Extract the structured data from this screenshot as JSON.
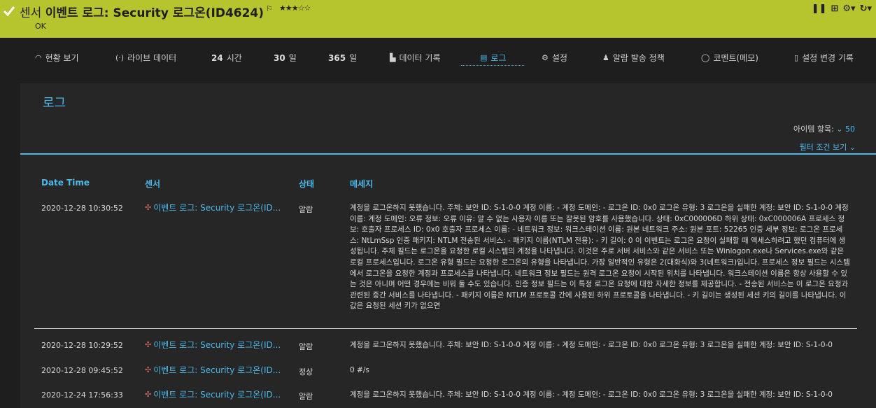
{
  "header": {
    "title_prefix": "센서",
    "title_main": "이벤트 로그: Security 로그온(ID4624)",
    "stars": "★★★☆☆",
    "status": "OK",
    "flag_icon": "flag-icon",
    "icons": [
      "pause-icon",
      "add-icon",
      "settings-icon",
      "refresh-icon"
    ]
  },
  "tabs": [
    {
      "label": "현황 보기",
      "icon": "overview-icon"
    },
    {
      "label": "라이브 데이터",
      "icon": "live-data-icon"
    },
    {
      "num": "24",
      "label": "시간"
    },
    {
      "num": "30",
      "label": "일"
    },
    {
      "num": "365",
      "label": "일"
    },
    {
      "label": "데이터 기록",
      "icon": "history-icon"
    },
    {
      "label": "로그",
      "icon": "log-icon"
    },
    {
      "label": "설정",
      "icon": "gear-icon"
    },
    {
      "label": "알람 발송 정책",
      "icon": "bell-icon"
    },
    {
      "label": "코멘트(메모)",
      "icon": "comment-icon"
    },
    {
      "label": "설정 변경 기록",
      "icon": "change-log-icon"
    }
  ],
  "panel": {
    "title": "로그",
    "items_label": "아이템 항목:",
    "items_value": "50",
    "filter_label": "필터 조건 보기"
  },
  "table": {
    "columns": [
      "Date Time",
      "센서",
      "상태",
      "메세지"
    ],
    "rows": [
      {
        "date": "2020-12-28 10:30:52",
        "sensor": "이벤트 로그: Security 로그온(ID...",
        "state": "알람",
        "message": "계정을 로그온하지 못했습니다. 주체: 보안 ID: S-1-0-0 계정 이름: - 계정 도메인: - 로그온 ID: 0x0 로그온 유형: 3 로그온을 실패한 계정: 보안 ID: S-1-0-0 계정 이름: 계정 도메인: 오류 정보: 오류 이유: 알 수 없는 사용자 이름 또는 잘못된 암호를 사용했습니다. 상태: 0xC000006D 하위 상태: 0xC000006A 프로세스 정보: 호출자 프로세스 ID: 0x0 호출자 프로세스 이름: - 네트워크 정보: 워크스테이션 이름: 원본 네트워크 주소: 원본 포트: 52265 인증 세부 정보: 로그온 프로세스: NtLmSsp 인증 패키지: NTLM 전송된 서비스: - 패키지 이름(NTLM 전용): - 키 길이: 0 이 이벤트는 로그온 요청이 실패할 때 액세스하려고 했던 컴퓨터에 생성됩니다. 주체 필드는 로그온을 요청한 로컬 시스템의 계정을 나타냅니다. 이것은 주로 서버 서비스와 같은 서비스 또는 Winlogon.exe나 Services.exe와 같은 로컬 프로세스입니다. 로그온 유형 필드는 요청한 로그온의 유형을 나타냅니다. 가장 일반적인 유형은 2(대화식)와 3(네트워크)입니다. 프로세스 정보 필드는 시스템에서 로그온을 요청한 계정과 프로세스를 나타냅니다. 네트워크 정보 필드는 원격 로그온 요청이 시작된 위치를 나타냅니다. 워크스테이션 이름은 항상 사용할 수 있는 것은 아니며 어떤 경우에는 비워 둘 수도 있습니다. 인증 정보 필드는 이 특정 로그온 요청에 대한 자세한 정보를 제공합니다. - 전송된 서비스는 이 로그온 요청과 관련된 중간 서비스를 나타냅니다. - 패키지 이름은 NTLM 프로토콜 간에 사용된 하위 프로토콜을 나타냅니다. - 키 길이는 생성된 세션 키의 길이를 나타냅니다. 이 값은 요청된 세션 키가 없으면"
      },
      {
        "date": "2020-12-28 10:29:52",
        "sensor": "이벤트 로그: Security 로그온(ID...",
        "state": "알람",
        "message": "계정을 로그온하지 못했습니다. 주체: 보안 ID: S-1-0-0 계정 이름: - 계정 도메인: - 로그온 ID: 0x0 로그온 유형: 3 로그온을 실패한 계정: 보안 ID: S-1-0-0"
      },
      {
        "date": "2020-12-28 09:45:52",
        "sensor": "이벤트 로그: Security 로그온(ID...",
        "state": "정상",
        "message": "0 #/s"
      },
      {
        "date": "2020-12-24 17:56:33",
        "sensor": "이벤트 로그: Security 로그온(ID...",
        "state": "알람",
        "message": "계정을 로그온하지 못했습니다. 주체: 보안 ID: S-1-0-0 계정 이름: - 계정 도메인: - 로그온 ID: 0x0 로그온 유형: 3 로그온을 실패한 계정: 보안 ID: S-1-0-0"
      }
    ]
  },
  "colors": {
    "header_bg": "#b6c42e",
    "accent": "#4bb8e8",
    "bg": "#1e1e1e",
    "panel_bg": "#262626"
  }
}
